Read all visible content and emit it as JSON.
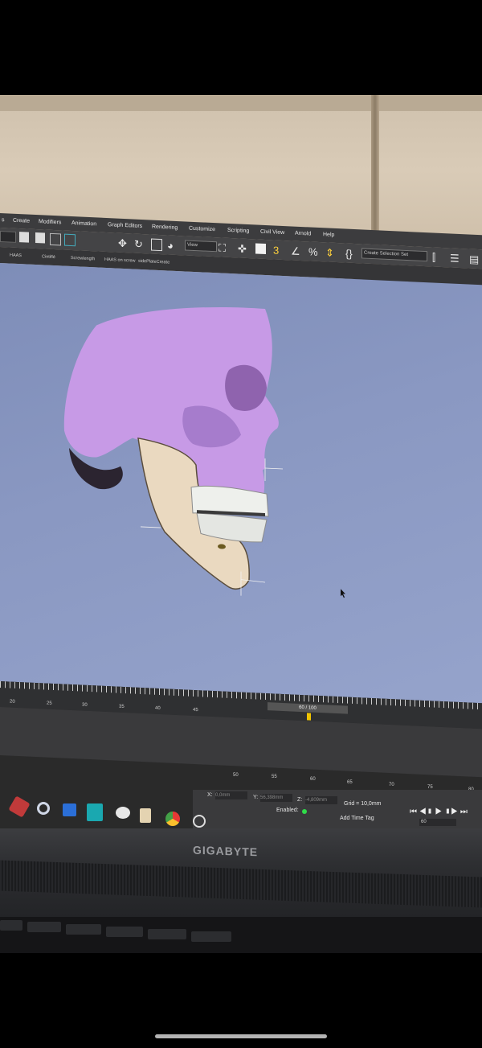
{
  "menu": [
    "Create",
    "Modifiers",
    "Animation",
    "Graph Editors",
    "Rendering",
    "Customize",
    "Scripting",
    "Civil View",
    "Arnold",
    "Help"
  ],
  "toolbar": {
    "view_dropdown": "View",
    "selection_set": "Create Selection Set"
  },
  "ribbon": [
    "HAAS",
    "Cintiflé",
    "Screwlength",
    "HAAS on screw",
    "sidePlateCreate"
  ],
  "timeline": {
    "frame": "60 / 100",
    "ticks": [
      "20",
      "25",
      "30",
      "35",
      "40",
      "45",
      "50",
      "55",
      "60",
      "65",
      "70",
      "75",
      "80"
    ]
  },
  "status": {
    "x_label": "X:",
    "x_value": "0,0mm",
    "y_label": "Y:",
    "y_value": "56,398mm",
    "z_label": "Z:",
    "z_value": "-4,809mm",
    "grid": "Grid = 10,0mm",
    "enabled": "Enabled:",
    "add_time_tag": "Add Time Tag",
    "frame_field": "60"
  },
  "laptop": {
    "brand": "GIGABYTE"
  },
  "colors": {
    "skull": "#c79ae6",
    "mandible": "#ead9c0",
    "viewport": "#8a98c2"
  },
  "icons": [
    "move-icon",
    "rotate-icon",
    "scale-icon",
    "snap-icon",
    "angle-snap-icon",
    "percent-snap-icon",
    "spinner-snap-icon",
    "mirror-icon",
    "align-icon",
    "layer-icon",
    "chrome-icon",
    "office-icon",
    "3dsmax-icon"
  ]
}
